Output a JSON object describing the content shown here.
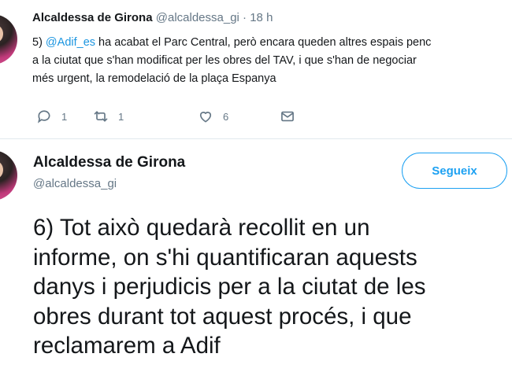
{
  "tweet1": {
    "name": "Alcaldessa de Girona",
    "handle": "@alcaldessa_gi",
    "separator": "·",
    "time": "18 h",
    "text_prefix": "5) ",
    "mention": "@Adif_es",
    "text_line1_rest": " ha acabat el Parc Central, però encara queden altres espais penc",
    "text_line2": "a la ciutat que s'han modificat per les obres del TAV, i que s'han de negociar",
    "text_line3": "més urgent, la remodelació de la plaça Espanya",
    "actions": {
      "reply_icon": "reply-icon",
      "reply_count": "1",
      "retweet_icon": "retweet-icon",
      "retweet_count": "1",
      "like_icon": "heart-icon",
      "like_count": "6",
      "dm_icon": "envelope-icon"
    }
  },
  "tweet2": {
    "name": "Alcaldessa de Girona",
    "handle": "@alcaldessa_gi",
    "follow_label": "Segueix",
    "text_lines": [
      "6) Tot això quedarà recollit en un",
      "informe, on s'hi quantificaran aquests",
      "danys i perjudicis per a la ciutat de les",
      "obres durant tot aquest procés, i que",
      "reclamarem a Adif"
    ]
  },
  "colors": {
    "accent": "#1da1f2",
    "mention": "#1b95e0",
    "text": "#14171a",
    "muted": "#657786",
    "divider": "#e1e8ed"
  }
}
